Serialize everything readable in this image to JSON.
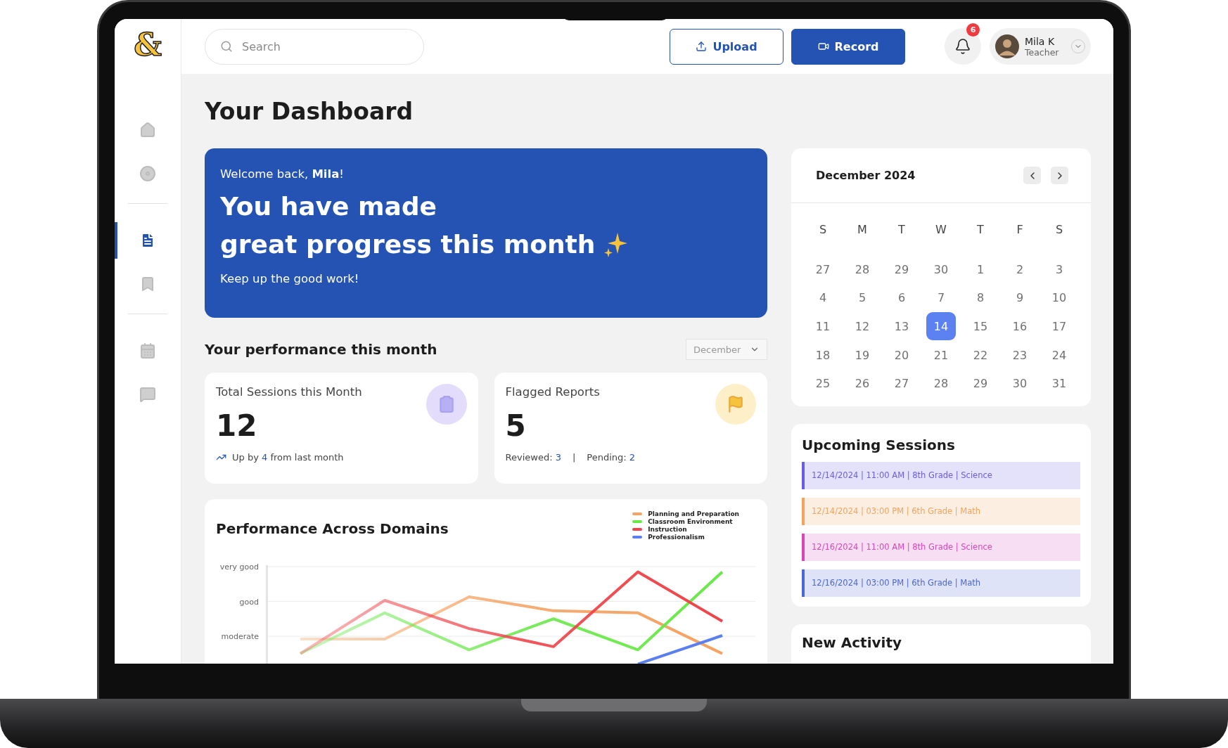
{
  "logo": "&",
  "sidebar": {
    "groups": [
      {
        "items": [
          {
            "selected": false
          },
          {
            "selected": false
          }
        ]
      },
      {
        "items": [
          {
            "selected": true
          },
          {
            "selected": false
          }
        ]
      },
      {
        "items": [
          {
            "selected": false
          },
          {
            "selected": false
          }
        ]
      }
    ]
  },
  "top_bar": {
    "search": {
      "placeholder": "Search"
    },
    "buttons": [
      {
        "label": "Upload",
        "kind": "outline"
      },
      {
        "label": "Record",
        "kind": "primary"
      }
    ],
    "notifications": {
      "badge": "6"
    },
    "user": {
      "name": "Mila K",
      "role": "Teacher"
    }
  },
  "page_title": "Your Dashboard",
  "banner": {
    "greeting": "Welcome back, **Mila**!",
    "headline": [
      "You have made",
      "great progress this month"
    ],
    "subtext": "Keep up the good work!"
  },
  "performance": {
    "title": "Your performance this month",
    "month_select": "December",
    "stats": [
      {
        "kind": "trend",
        "title": "Total Sessions this Month",
        "value": "12",
        "prefix": "Up by",
        "highlight": "4",
        "suffix": "from last month"
      },
      {
        "kind": "breakdown",
        "title": "Flagged Reports",
        "value": "5",
        "parts": [
          {
            "label": "Reviewed:",
            "value": "3"
          },
          {
            "label": "Pending:",
            "value": "2"
          }
        ],
        "separator": "|"
      }
    ]
  },
  "domains": {
    "title": "Performance Across Domains",
    "y_labels": [
      "very good",
      "good",
      "moderate"
    ],
    "legend": [
      {
        "name": "Planning and Preparation",
        "color": "#f5a262"
      },
      {
        "name": "Classroom Environment",
        "color": "#6ae84a"
      },
      {
        "name": "Instruction",
        "color": "#ef4349"
      },
      {
        "name": "Professionalism",
        "color": "#5b7ef0"
      }
    ]
  },
  "calendar": {
    "title": "December 2024",
    "weekdays": [
      "S",
      "M",
      "T",
      "W",
      "T",
      "F",
      "S"
    ],
    "days": [
      {
        "label": "27",
        "selected": false
      },
      {
        "label": "28",
        "selected": false
      },
      {
        "label": "29",
        "selected": false
      },
      {
        "label": "30",
        "selected": false
      },
      {
        "label": "1",
        "selected": false
      },
      {
        "label": "2",
        "selected": false
      },
      {
        "label": "3",
        "selected": false
      },
      {
        "label": "4",
        "selected": false
      },
      {
        "label": "5",
        "selected": false
      },
      {
        "label": "6",
        "selected": false
      },
      {
        "label": "7",
        "selected": false
      },
      {
        "label": "8",
        "selected": false
      },
      {
        "label": "9",
        "selected": false
      },
      {
        "label": "10",
        "selected": false
      },
      {
        "label": "11",
        "selected": false
      },
      {
        "label": "12",
        "selected": false
      },
      {
        "label": "13",
        "selected": false
      },
      {
        "label": "14",
        "selected": true
      },
      {
        "label": "15",
        "selected": false
      },
      {
        "label": "16",
        "selected": false
      },
      {
        "label": "17",
        "selected": false
      },
      {
        "label": "18",
        "selected": false
      },
      {
        "label": "19",
        "selected": false
      },
      {
        "label": "20",
        "selected": false
      },
      {
        "label": "21",
        "selected": false
      },
      {
        "label": "22",
        "selected": false
      },
      {
        "label": "23",
        "selected": false
      },
      {
        "label": "24",
        "selected": false
      },
      {
        "label": "25",
        "selected": false
      },
      {
        "label": "26",
        "selected": false
      },
      {
        "label": "27",
        "selected": false
      },
      {
        "label": "28",
        "selected": false
      },
      {
        "label": "29",
        "selected": false
      },
      {
        "label": "30",
        "selected": false
      },
      {
        "label": "31",
        "selected": false
      }
    ]
  },
  "upcoming": {
    "title": "Upcoming Sessions",
    "sessions": [
      {
        "text": "12/14/2024 | 11:00 AM | 8th Grade | Science",
        "color": "#6b5ce7"
      },
      {
        "text": "12/14/2024 | 03:00 PM | 6th Grade | Math",
        "color": "#f5a25d"
      },
      {
        "text": "12/16/2024 | 11:00 AM | 8th Grade | Science",
        "color": "#d946b8"
      },
      {
        "text": "12/16/2024 | 03:00 PM | 6th Grade | Math",
        "color": "#4b66d6"
      }
    ]
  },
  "new_activity": {
    "title": "New Activity"
  }
}
